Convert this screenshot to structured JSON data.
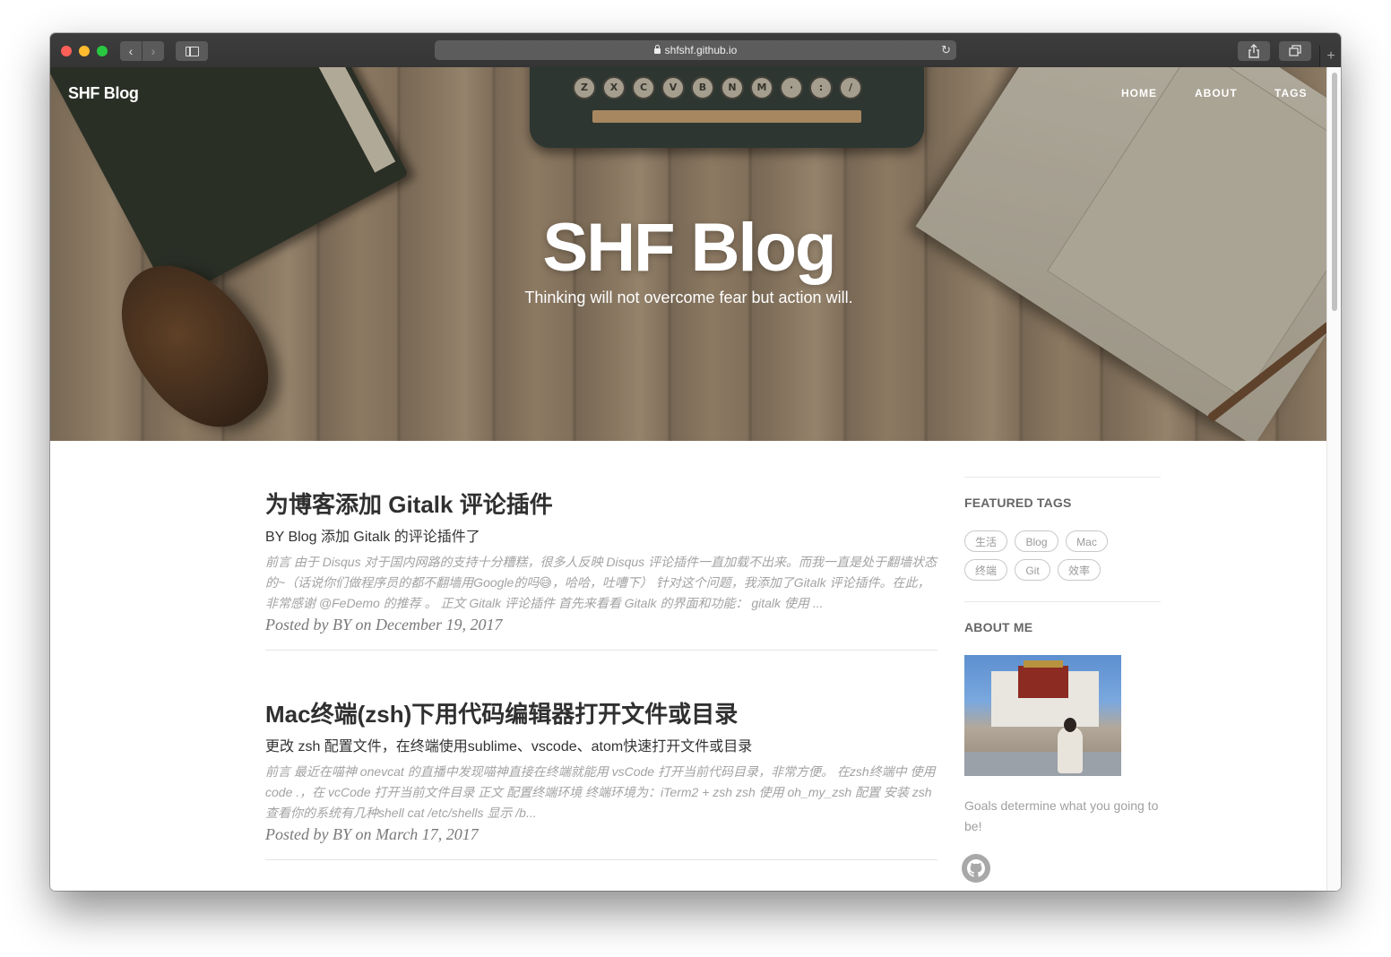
{
  "browser": {
    "url": "shfshf.github.io",
    "nav_back": "‹",
    "nav_forward": "›",
    "new_tab": "+",
    "reload": "↻"
  },
  "site": {
    "brand": "SHF Blog",
    "nav": [
      {
        "label": "HOME"
      },
      {
        "label": "ABOUT"
      },
      {
        "label": "TAGS"
      }
    ],
    "hero_title": "SHF Blog",
    "hero_subtitle": "Thinking will not overcome fear but action will.",
    "hero_keys": [
      "Z",
      "X",
      "C",
      "V",
      "B",
      "N",
      "M",
      "·",
      ":",
      "/"
    ]
  },
  "posts": [
    {
      "title": "为博客添加 Gitalk 评论插件",
      "subtitle": "BY Blog 添加 Gitalk 的评论插件了",
      "excerpt": "前言 由于 Disqus 对于国内网路的支持十分糟糕，很多人反映 Disqus 评论插件一直加载不出来。而我一直是处于翻墙状态的~（话说你们做程序员的都不翻墙用Google的吗😅，哈哈，吐嘈下） 针对这个问题，我添加了Gitalk 评论插件。在此，非常感谢 @FeDemo 的推荐 。 正文 Gitalk 评论插件 首先来看看 Gitalk 的界面和功能： gitalk 使用 ...",
      "meta": "Posted by BY on December 19, 2017"
    },
    {
      "title": "Mac终端(zsh)下用代码编辑器打开文件或目录",
      "subtitle": "更改 zsh 配置文件，在终端使用sublime、vscode、atom快速打开文件或目录",
      "excerpt": "前言 最近在喵神 onevcat 的直播中发现喵神直接在终端就能用 vsCode 打开当前代码目录，非常方便。 在zsh终端中 使用 code .，在 vcCode 打开当前文件目录 正文 配置终端环境 终端环境为：iTerm2 + zsh zsh 使用 oh_my_zsh 配置 安装 zsh 查看你的系统有几种shell cat /etc/shells 显示 /b...",
      "meta": "Posted by BY on March 17, 2017"
    }
  ],
  "sidebar": {
    "featured_tags_heading": "FEATURED TAGS",
    "tags": [
      "生活",
      "Blog",
      "Mac",
      "终端",
      "Git",
      "效率"
    ],
    "about_heading": "ABOUT ME",
    "about_text": "Goals determine what you going to be!"
  }
}
